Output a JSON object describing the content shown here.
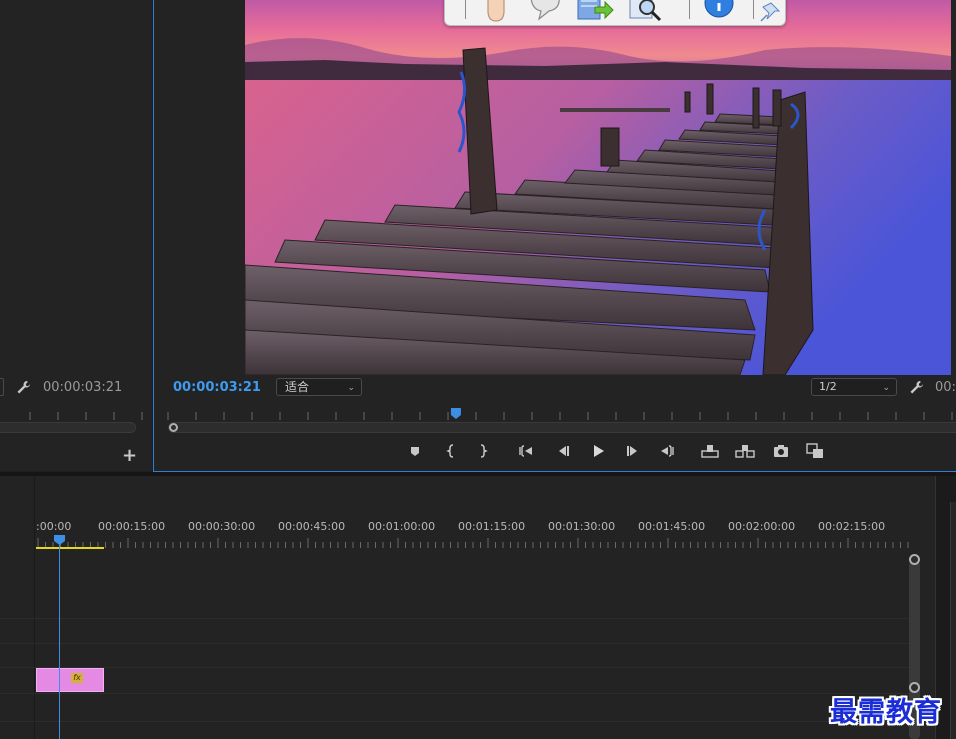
{
  "source_monitor": {
    "timecode": "00:00:03:21",
    "add_button_label": "+"
  },
  "program_monitor": {
    "playhead_timecode": "00:00:03:21",
    "zoom_select": "适合",
    "resolution_select": "1/2",
    "duration_timecode_partial": "00:0",
    "playhead_fraction": 0.364
  },
  "timeline": {
    "time_labels": [
      ":00:00",
      "00:00:15:00",
      "00:00:30:00",
      "00:00:45:00",
      "00:01:00:00",
      "00:01:15:00",
      "00:01:30:00",
      "00:01:45:00",
      "00:02:00:00",
      "00:02:15:00"
    ],
    "clip_fx_badge": "fx",
    "colors": {
      "clip": "#e48ae4",
      "work_area": "#e6d61e",
      "playhead": "#3d8fe6"
    }
  },
  "watermark": {
    "text": "最需教育"
  },
  "icons": [
    "hand-icon",
    "comment-icon",
    "export-icon",
    "zoom-icon",
    "info-icon",
    "pin-icon",
    "wrench-icon",
    "marker-icon",
    "mark-in-icon",
    "mark-out-icon",
    "go-to-in-icon",
    "step-back-icon",
    "play-icon",
    "step-forward-icon",
    "go-to-out-icon",
    "lift-icon",
    "extract-icon",
    "camera-icon",
    "compare-icon"
  ]
}
